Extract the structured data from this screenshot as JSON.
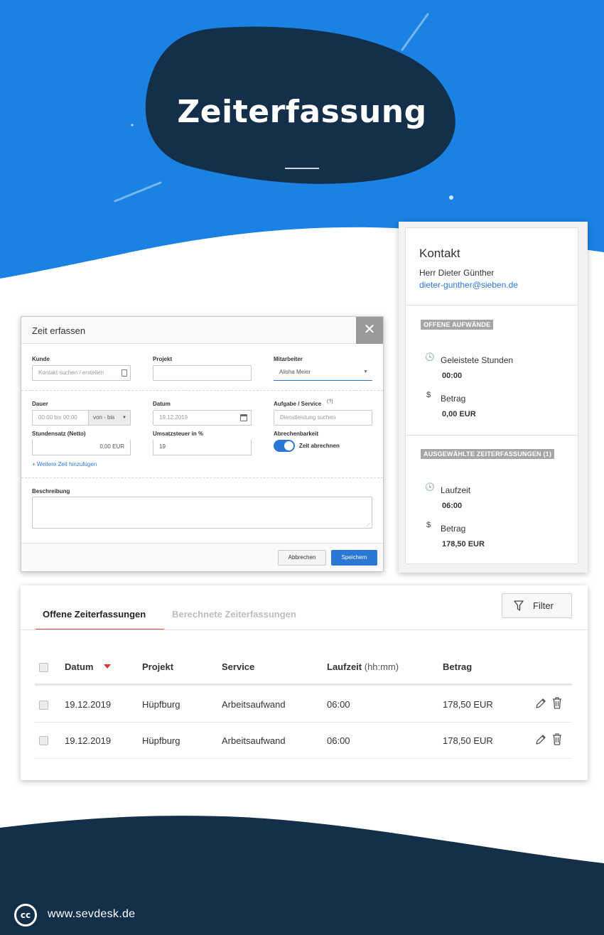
{
  "colors": {
    "hero_blue": "#1a82e2",
    "navy": "#132f4a",
    "accent_blue": "#2b78d4",
    "tab_red": "#e04b3f"
  },
  "hero": {
    "title": "Zeiterfassung"
  },
  "dialog": {
    "title": "Zeit erfassen",
    "close_icon": "close-icon",
    "kunde": {
      "label": "Kunde",
      "placeholder": "Kontakt suchen / erstellen"
    },
    "projekt": {
      "label": "Projekt",
      "value": ""
    },
    "mitarbeiter": {
      "label": "Mitarbeiter",
      "value": "Alisha Meier"
    },
    "dauer": {
      "label": "Dauer",
      "placeholder": "00:00 bis 00:00",
      "mode": "von - bis"
    },
    "datum": {
      "label": "Datum",
      "placeholder": "19.12.2019"
    },
    "aufgabe": {
      "label": "Aufgabe / Service",
      "placeholder": "Dienstleistung suchen"
    },
    "stundensatz": {
      "label": "Stundensatz (Netto)",
      "value": "0,00 EUR"
    },
    "umsatzsteuer": {
      "label": "Umsatzsteuer in %",
      "value": "19"
    },
    "abrechenbarkeit": {
      "label": "Abrechenbarkeit",
      "toggle_label": "Zeit abrechnen",
      "enabled": true
    },
    "add_time_link": "+ Weitere Zeit hinzufügen",
    "beschreibung": {
      "label": "Beschreibung",
      "value": ""
    },
    "cancel_label": "Abbrechen",
    "save_label": "Speichern"
  },
  "contact_panel": {
    "heading": "Kontakt",
    "name": "Herr Dieter Günther",
    "email": "dieter-gunther@sieben.de",
    "open_badge": "OFFENE AUFWÄNDE",
    "hours_label": "Geleistete Stunden",
    "hours_value": "00:00",
    "amount_label": "Betrag",
    "amount_value": "0,00 EUR",
    "selected_badge": "AUSGEWÄHLTE ZEITERFASSUNGEN (1)",
    "runtime_label": "Laufzeit",
    "runtime_value": "06:00",
    "selected_amount_label": "Betrag",
    "selected_amount_value": "178,50 EUR"
  },
  "table_card": {
    "tabs": [
      {
        "label": "Offene Zeiterfassungen",
        "active": true
      },
      {
        "label": "Berechnete Zeiterfassungen",
        "active": false
      }
    ],
    "filter_label": "Filter",
    "columns": {
      "datum": "Datum",
      "projekt": "Projekt",
      "service": "Service",
      "laufzeit": "Laufzeit",
      "laufzeit_unit": "(hh:mm)",
      "betrag": "Betrag"
    },
    "rows": [
      {
        "datum": "19.12.2019",
        "projekt": "Hüpfburg",
        "service": "Arbeitsaufwand",
        "laufzeit": "06:00",
        "betrag": "178,50 EUR"
      },
      {
        "datum": "19.12.2019",
        "projekt": "Hüpfburg",
        "service": "Arbeitsaufwand",
        "laufzeit": "06:00",
        "betrag": "178,50 EUR"
      }
    ]
  },
  "footer": {
    "cc_text": "cc",
    "url": "www.sevdesk.de"
  }
}
